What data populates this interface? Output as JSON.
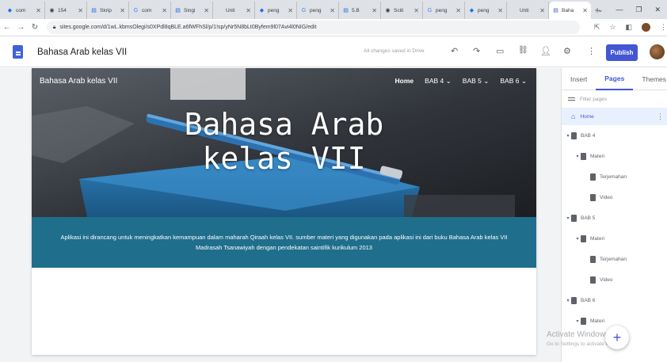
{
  "browser": {
    "tabs": [
      {
        "label": "com",
        "icon": "diamond-icon",
        "color": "#1a73e8"
      },
      {
        "label": "154",
        "icon": "globe-icon",
        "color": "#3c4043"
      },
      {
        "label": "Skrip",
        "icon": "doc-icon",
        "color": "#1a73e8"
      },
      {
        "label": "com",
        "icon": "google-icon",
        "color": "#4285f4"
      },
      {
        "label": "Singi",
        "icon": "doc-icon",
        "color": "#1a73e8"
      },
      {
        "label": "Unti",
        "icon": "blank-icon",
        "color": "#9aa0a6"
      },
      {
        "label": "peng",
        "icon": "diamond-icon",
        "color": "#1a73e8"
      },
      {
        "label": "peng",
        "icon": "google-icon",
        "color": "#4285f4"
      },
      {
        "label": "5.B",
        "icon": "doc-icon",
        "color": "#1a73e8"
      },
      {
        "label": "Sciti",
        "icon": "globe-icon",
        "color": "#3c4043"
      },
      {
        "label": "peng",
        "icon": "google-icon",
        "color": "#4285f4"
      },
      {
        "label": "peng",
        "icon": "diamond-icon",
        "color": "#1a73e8"
      },
      {
        "label": "Unti",
        "icon": "blank-icon",
        "color": "#9aa0a6"
      },
      {
        "label": "Baha",
        "icon": "sites-icon",
        "color": "#4356d4"
      }
    ],
    "url": "sites.google.com/d/1wL.kbmsOlegi/s0XPdl8qBLE.a6fWFhSl/p/1!sp/yNr5N8bLt0Byfem9l07Avi4l0NIG/edit"
  },
  "editor": {
    "doc_title": "Bahasa Arab kelas VII",
    "saved_status": "All changes saved in Drive",
    "publish_label": "Publish"
  },
  "site": {
    "name": "Bahasa Arab kelas VII",
    "nav": [
      {
        "label": "Home"
      },
      {
        "label": "BAB 4"
      },
      {
        "label": "BAB 5"
      },
      {
        "label": "BAB 6"
      }
    ],
    "hero_line1": "Bahasa Arab",
    "hero_line2": "kelas VII",
    "description": "Aplikasi ini dirancang untuk meningkatkan kemampuan dalam maharah Qiraah kelas VII. sumber materi yang digunakan pada aplikasi ini dari buku Bahasa Arab kelas VII Madrasah Tsanawiyah dengan pendekatan saintifik kurikulum 2013",
    "band_color": "#1f6e8c"
  },
  "panel": {
    "tabs": [
      "Insert",
      "Pages",
      "Themes"
    ],
    "active_tab": "Pages",
    "filter_placeholder": "Filter pages",
    "pages": [
      {
        "label": "Home",
        "level": 0,
        "caret": false,
        "home": true
      },
      {
        "label": "BAB 4",
        "level": 0,
        "caret": true
      },
      {
        "label": "Materi",
        "level": 1,
        "caret": true
      },
      {
        "label": "Terjemahan",
        "level": 2,
        "caret": false
      },
      {
        "label": "Video",
        "level": 2,
        "caret": false
      },
      {
        "label": "BAB 5",
        "level": 0,
        "caret": true
      },
      {
        "label": "Materi",
        "level": 1,
        "caret": true
      },
      {
        "label": "Terjemahan",
        "level": 2,
        "caret": false
      },
      {
        "label": "Video",
        "level": 2,
        "caret": false
      },
      {
        "label": "BAB 6",
        "level": 0,
        "caret": true
      },
      {
        "label": "Materi",
        "level": 1,
        "caret": true
      }
    ]
  },
  "watermark": {
    "title": "Activate Windows",
    "subtitle": "Go to Settings to activate Windows."
  }
}
